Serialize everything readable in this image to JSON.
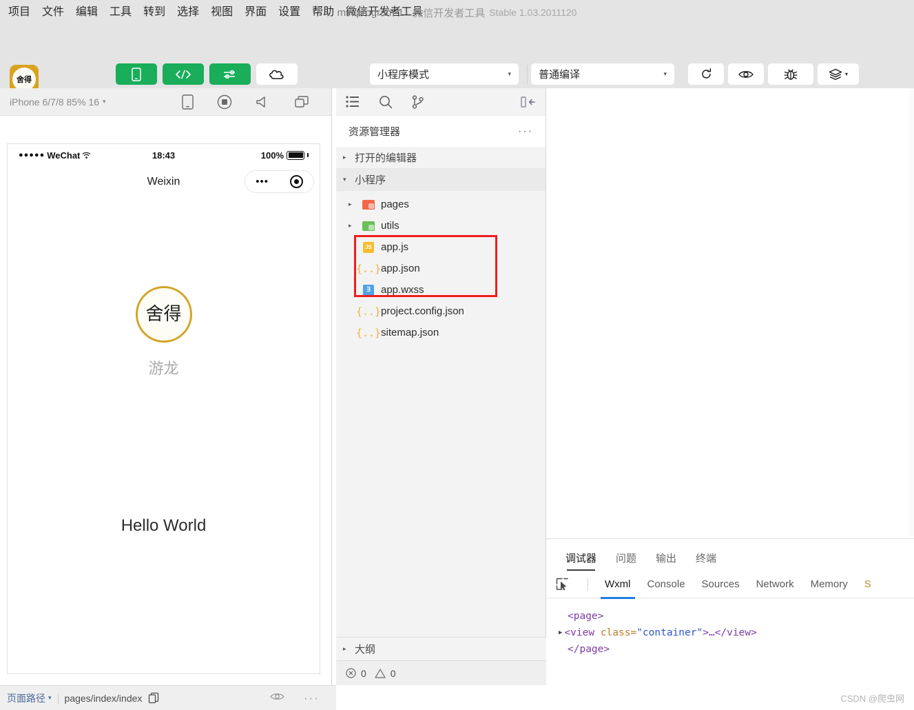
{
  "menu": {
    "items": [
      "项目",
      "文件",
      "编辑",
      "工具",
      "转到",
      "选择",
      "视图",
      "界面",
      "设置",
      "帮助",
      "微信开发者工具"
    ]
  },
  "window": {
    "project_name": "miniprogram-1",
    "separator": "-",
    "app_name": "微信开发者工具",
    "version": "Stable 1.03.2011120"
  },
  "toolbar": {
    "logo_text": "舍得",
    "left_buttons": [
      {
        "label": "模拟器",
        "icon": "phone-icon",
        "style": "green"
      },
      {
        "label": "编辑器",
        "icon": "code-icon",
        "style": "green"
      },
      {
        "label": "调试器",
        "icon": "sliders-icon",
        "style": "green"
      },
      {
        "label": "云开发",
        "icon": "cloud-dev-icon",
        "style": "white"
      }
    ],
    "mode_select": {
      "value": "小程序模式",
      "caret": "▾"
    },
    "compile_select": {
      "value": "普通编译",
      "caret": "▾"
    },
    "right_buttons": [
      {
        "label": "编译",
        "icon": "refresh-icon",
        "has_caret": false
      },
      {
        "label": "预览",
        "icon": "eye-icon",
        "has_caret": false
      },
      {
        "label": "真机调试",
        "icon": "bug-icon",
        "has_caret": false
      },
      {
        "label": "清缓存",
        "icon": "layers-icon",
        "has_caret": true
      }
    ]
  },
  "simulator": {
    "device_label": "iPhone 6/7/8 85% 16",
    "device_caret": "▾",
    "header_icons": [
      "device-rotate-icon",
      "record-icon",
      "volume-icon",
      "multi-window-icon"
    ],
    "phone": {
      "status_dots": "●●●●●",
      "carrier": "WeChat",
      "wifi_icon": "wifi-icon",
      "time": "18:43",
      "battery_percent": "100%",
      "nav_title": "Weixin",
      "capsule_dots": "•••",
      "capsule_target": "target-icon",
      "brand_logo_text": "舍得",
      "brand_name": "游龙",
      "hello_text": "Hello World"
    }
  },
  "bottom_bar": {
    "page_path_label": "页面路径",
    "page_path_caret": "▾",
    "path_value": "pages/index/index",
    "copy_icon": "copy-icon",
    "eye_icon": "eye-icon",
    "more_icon": "more-icon"
  },
  "explorer": {
    "icons": [
      "explorer-list-icon",
      "search-icon",
      "source-control-icon"
    ],
    "collapse_icon": "collapse-sidebar-icon",
    "title": "资源管理器",
    "more": "···",
    "sections": [
      {
        "label": "打开的编辑器",
        "expanded": false,
        "arrow": "▸"
      },
      {
        "label": "小程序",
        "expanded": true,
        "arrow": "▾"
      }
    ],
    "tree": [
      {
        "name": "pages",
        "type": "folder",
        "icon": "folder-red-icon",
        "arrow": "▸",
        "highlighted": false
      },
      {
        "name": "utils",
        "type": "folder",
        "icon": "folder-green-icon",
        "arrow": "▸",
        "highlighted": false
      },
      {
        "name": "app.js",
        "type": "file",
        "icon": "js-file-icon",
        "highlighted": true
      },
      {
        "name": "app.json",
        "type": "file",
        "icon": "json-file-icon",
        "highlighted": true
      },
      {
        "name": "app.wxss",
        "type": "file",
        "icon": "wxss-file-icon",
        "highlighted": true
      },
      {
        "name": "project.config.json",
        "type": "file",
        "icon": "json-file-icon",
        "highlighted": false
      },
      {
        "name": "sitemap.json",
        "type": "file",
        "icon": "json-file-icon",
        "highlighted": false
      }
    ],
    "outline_label": "大纲",
    "outline_arrow": "▸",
    "status": {
      "error_icon": "error-circle-icon",
      "error_count": "0",
      "warn_icon": "warning-triangle-icon",
      "warn_count": "0"
    },
    "highlight_color": "#f01c1c"
  },
  "debugger": {
    "tabs": [
      {
        "label": "调试器",
        "active": true
      },
      {
        "label": "问题",
        "active": false
      },
      {
        "label": "输出",
        "active": false
      },
      {
        "label": "终端",
        "active": false
      }
    ],
    "picker_icon": "element-picker-icon",
    "sub_tabs": [
      {
        "label": "Wxml",
        "active": true
      },
      {
        "label": "Console",
        "active": false
      },
      {
        "label": "Sources",
        "active": false
      },
      {
        "label": "Network",
        "active": false
      },
      {
        "label": "Memory",
        "active": false
      },
      {
        "label": "S",
        "active": false,
        "truncated": true
      }
    ],
    "code": {
      "line1": "<page>",
      "line2_a": "<view ",
      "line2_b": "class=",
      "line2_c": "\"container\"",
      "line2_d": ">…</view>",
      "line3": "</page>",
      "triangle": "▶"
    }
  },
  "watermark": "CSDN @爬虫网"
}
